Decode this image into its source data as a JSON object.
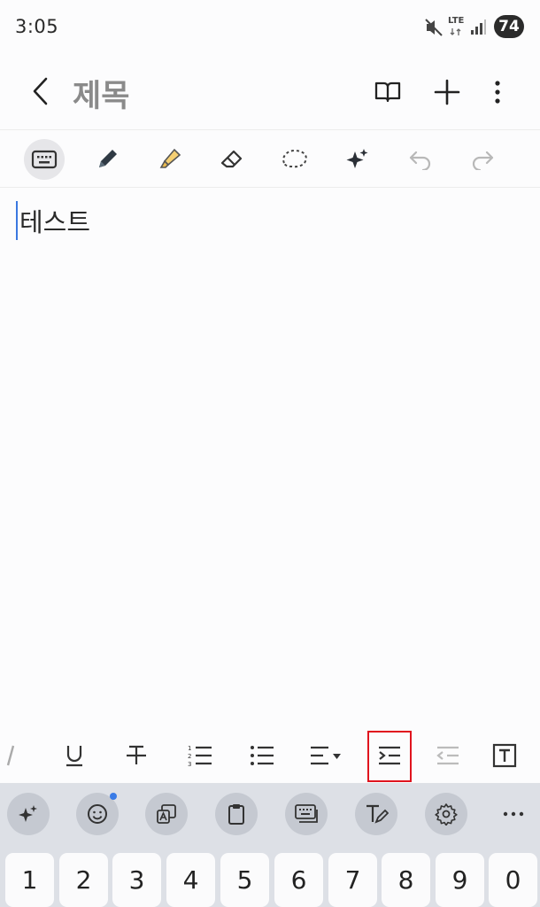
{
  "status_bar": {
    "time": "3:05",
    "network": "LTE",
    "battery": "74"
  },
  "header": {
    "title": "제목"
  },
  "toolbar": {
    "items": [
      "keyboard-mode",
      "pen",
      "highlighter",
      "eraser",
      "lasso",
      "ai-assist",
      "undo",
      "redo"
    ],
    "active": "keyboard-mode"
  },
  "editor": {
    "text": "테스트"
  },
  "format_bar": {
    "items": [
      "italic",
      "underline",
      "strikethrough",
      "numbered-list",
      "bulleted-list",
      "align",
      "indent",
      "outdent",
      "text-box"
    ],
    "highlighted": "indent"
  },
  "keyboard": {
    "suggestion_icons": [
      "galaxy-ai",
      "emoji",
      "translate",
      "clipboard",
      "keyboard-layout",
      "handwriting",
      "settings",
      "more"
    ],
    "number_keys": [
      "1",
      "2",
      "3",
      "4",
      "5",
      "6",
      "7",
      "8",
      "9",
      "0"
    ]
  },
  "colors": {
    "accent": "#3a78e0",
    "highlight_box": "#e0141e",
    "title": "#8a8a8a"
  }
}
